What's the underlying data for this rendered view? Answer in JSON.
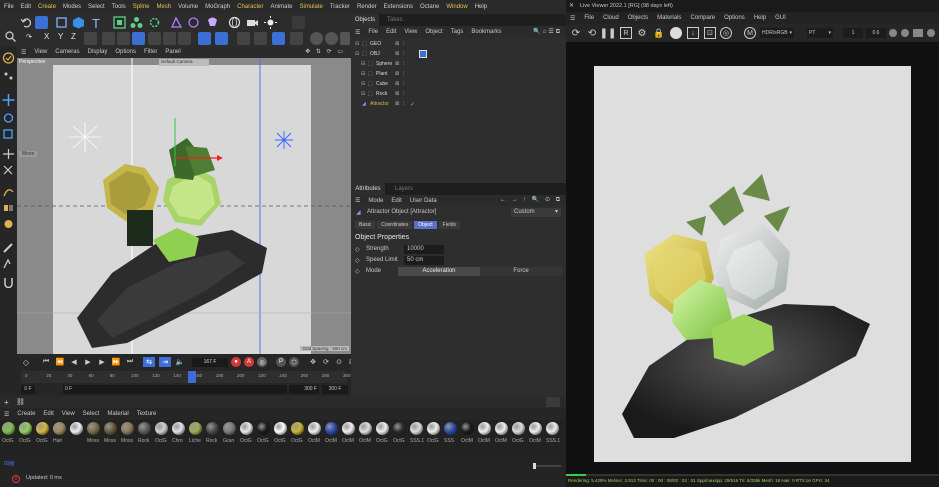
{
  "main_menu": {
    "items": [
      "File",
      "Edit",
      "Create",
      "Modes",
      "Select",
      "Tools",
      "Spline",
      "Mesh",
      "Volume",
      "MoGraph",
      "Character",
      "Animate",
      "Simulate",
      "Tracker",
      "Render",
      "Extensions",
      "Octane",
      "Window",
      "Help"
    ],
    "highlighted": [
      "Create",
      "Spline",
      "Mesh",
      "Character",
      "Simulate",
      "Window"
    ]
  },
  "toolbar": {
    "axis_x": "X",
    "axis_y": "Y",
    "axis_z": "Z"
  },
  "viewport": {
    "menu": [
      "View",
      "Cameras",
      "Display",
      "Options",
      "Filter",
      "Panel"
    ],
    "label": "Perspective",
    "camera_label": "Default Camera",
    "move_label": "Move",
    "grid_spacing": "Grid Spacing : 500 cm"
  },
  "timeline": {
    "current_frame": "167 F",
    "ticks": [
      "0",
      "20",
      "40",
      "60",
      "80",
      "100",
      "120",
      "140",
      "160",
      "180",
      "200",
      "220",
      "240",
      "260",
      "280",
      "300"
    ],
    "start_frame": "0 F",
    "min_frame": "0 F",
    "end_frame": "300 F",
    "max_frame": "300 F"
  },
  "objects_panel": {
    "tabs": [
      "Objects",
      "Takes"
    ],
    "menu": [
      "File",
      "Edit",
      "View",
      "Object",
      "Tags",
      "Bookmarks"
    ],
    "items": [
      {
        "name": "GEO",
        "indent": 0
      },
      {
        "name": "OBJ",
        "indent": 0
      },
      {
        "name": "Sphere",
        "indent": 1
      },
      {
        "name": "Plant",
        "indent": 1
      },
      {
        "name": "Cube",
        "indent": 1
      },
      {
        "name": "Rock",
        "indent": 1
      },
      {
        "name": "Attractor",
        "indent": 0
      }
    ]
  },
  "attributes": {
    "tabs": [
      "Attributes",
      "Layers"
    ],
    "menu": [
      "Mode",
      "Edit",
      "User Data"
    ],
    "object_title": "Attractor Object [Attractor]",
    "preset": "Custom",
    "subtabs": [
      "Basic",
      "Coordinates",
      "Object",
      "Fields"
    ],
    "active_subtab": "Object",
    "section": "Object Properties",
    "strength_label": "Strength",
    "strength_value": "10000",
    "speed_label": "Speed Limit",
    "speed_value": "50 cm",
    "mode_label": "Mode",
    "mode_options": [
      "Acceleration",
      "Force"
    ],
    "active_mode": "Acceleration"
  },
  "materials": {
    "menu": [
      "Create",
      "Edit",
      "View",
      "Select",
      "Material",
      "Texture"
    ],
    "labels": [
      "OctG",
      "OctG",
      "OctG",
      "Hair",
      "",
      "Moss",
      "Moss",
      "Moss",
      "Rock",
      "OctG",
      "Chro",
      "Liche",
      "Rock",
      "Gran",
      "OctG",
      "OctG",
      "OctG",
      "OctG",
      "OctM",
      "OctM",
      "OctM",
      "OctM",
      "OctG",
      "OctG",
      "SSS.1",
      "OctG",
      "SSS",
      "OctM",
      "OctM",
      "OctM",
      "OctG",
      "OctM",
      "SSS.1"
    ]
  },
  "status": {
    "text": "Updated: 0 ms"
  },
  "live_viewer": {
    "title": "Live Viewer 2022.1 [RG] (98 days left)",
    "menu": [
      "File",
      "Cloud",
      "Objects",
      "Materials",
      "Compare",
      "Options",
      "Help",
      "GUI"
    ],
    "colorspace": "HDR/sRGB",
    "mode": "PT",
    "value1": "1",
    "value2": "0.6",
    "status_text": "Rendering: 5.428%   Ms/sec: 3.913   Time: 00 : 00 : 08/00 : 02 : 01   Spp/maxspp: 29/516   Tri: 5/336k   Mesh: 18   Hair: 0   RTX:on   GPU: 34"
  }
}
